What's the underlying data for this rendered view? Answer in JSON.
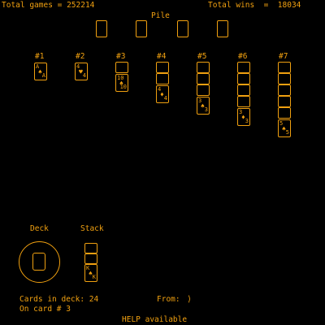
{
  "header": {
    "total_games_label": "Total games = 252214",
    "pile_label": "Pile",
    "total_wins_label": "Total wins  =  18034"
  },
  "pile_slots": 4,
  "columns": [
    {
      "label": "#1",
      "backs": 0,
      "face": {
        "rank": "A",
        "suit": "♠",
        "suit_name": "spade"
      }
    },
    {
      "label": "#2",
      "backs": 0,
      "face": {
        "rank": "4",
        "suit": "♥",
        "suit_name": "heart"
      }
    },
    {
      "label": "#3",
      "backs": 1,
      "face": {
        "rank": "10",
        "suit": "♠",
        "suit_name": "spade"
      }
    },
    {
      "label": "#4",
      "backs": 2,
      "face": {
        "rank": "4",
        "suit": "♦",
        "suit_name": "diamond"
      }
    },
    {
      "label": "#5",
      "backs": 3,
      "face": {
        "rank": "3",
        "suit": "♠",
        "suit_name": "spade"
      }
    },
    {
      "label": "#6",
      "backs": 4,
      "face": {
        "rank": "3",
        "suit": "♦",
        "suit_name": "diamond"
      }
    },
    {
      "label": "#7",
      "backs": 5,
      "face": {
        "rank": "5",
        "suit": "♠",
        "suit_name": "spade"
      }
    }
  ],
  "deck": {
    "label": "Deck"
  },
  "stack": {
    "label": "Stack",
    "backs": 2,
    "face": {
      "rank": "K",
      "suit": "♠",
      "suit_name": "spade"
    }
  },
  "footer": {
    "cards_in_deck": "Cards in deck: 24",
    "on_card": "On card # 3",
    "from_label": "From:",
    "from_icon": "chevron-right-icon",
    "help": "HELP available"
  },
  "colors": {
    "foreground": "#f0a010",
    "background": "#000000"
  }
}
